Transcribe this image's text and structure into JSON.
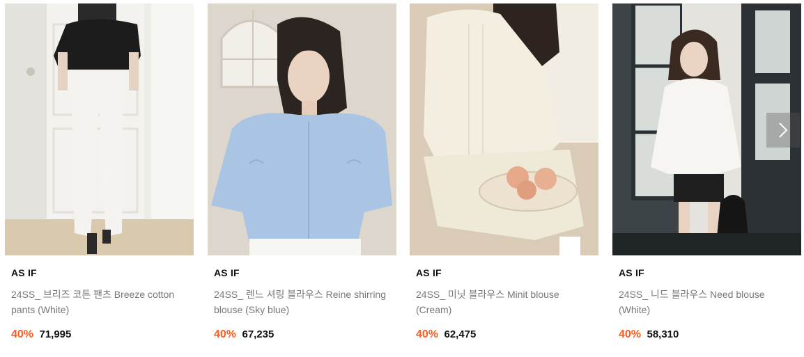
{
  "products": [
    {
      "brand": "AS IF",
      "name": "24SS_ 브리즈 코튼 팬츠 Breeze cotton pants (White)",
      "discount": "40%",
      "price": "71,995"
    },
    {
      "brand": "AS IF",
      "name": "24SS_ 렌느 셔링 블라우스 Reine shirring blouse (Sky blue)",
      "discount": "40%",
      "price": "67,235"
    },
    {
      "brand": "AS IF",
      "name": "24SS_ 미닛 블라우스 Minit blouse (Cream)",
      "discount": "40%",
      "price": "62,475"
    },
    {
      "brand": "AS IF",
      "name": "24SS_ 니드 블라우스 Need blouse (White)",
      "discount": "40%",
      "price": "58,310"
    }
  ],
  "icons": {
    "next": "chevron-right-icon"
  },
  "colors": {
    "discount": "#ff5a1f",
    "price": "#111111",
    "name": "#777777"
  }
}
